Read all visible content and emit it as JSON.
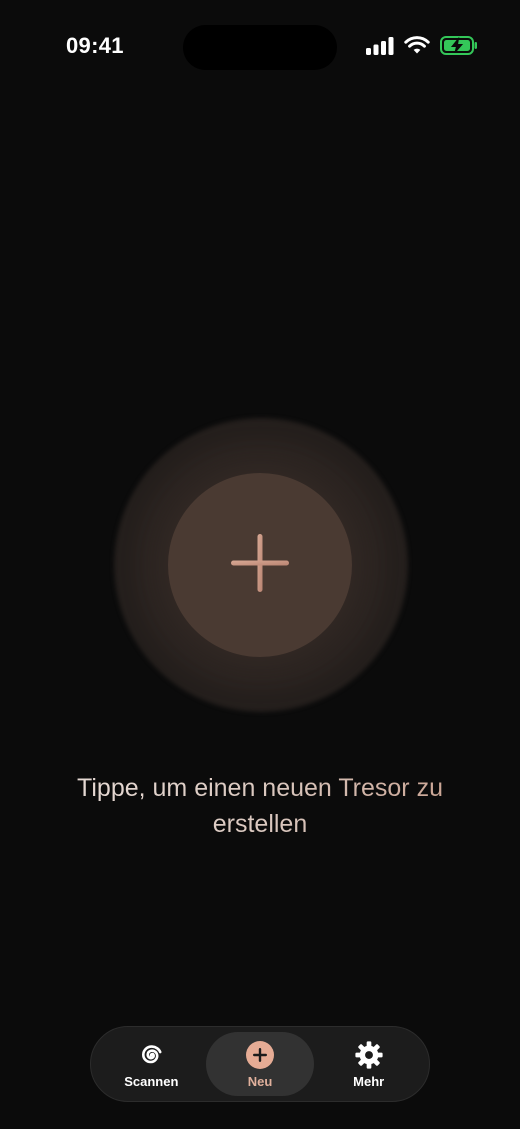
{
  "status_bar": {
    "time": "09:41",
    "icons": [
      "signal-icon",
      "wifi-icon",
      "battery-charging-icon"
    ],
    "battery_color": "#34c759"
  },
  "main": {
    "create_button_icon": "plus-icon",
    "hint": "Tippe, um einen neuen Tresor zu erstellen",
    "accent_color": "#c79e8c"
  },
  "tab_bar": {
    "tabs": [
      {
        "label": "Scannen",
        "icon": "spiral-scan-icon",
        "active": false
      },
      {
        "label": "Neu",
        "icon": "plus-circle-icon",
        "active": true
      },
      {
        "label": "Mehr",
        "icon": "gear-icon",
        "active": false
      }
    ]
  }
}
